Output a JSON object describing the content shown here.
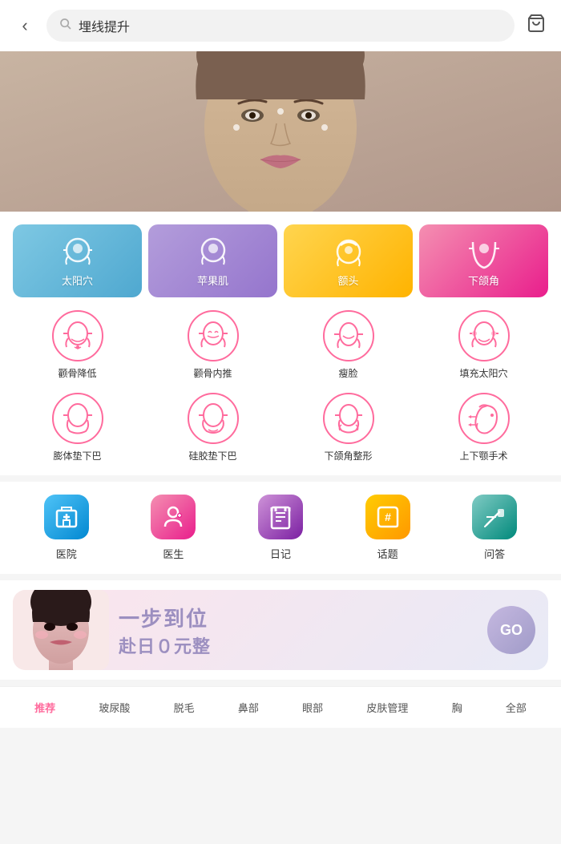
{
  "header": {
    "back_icon": "‹",
    "search_placeholder": "埋线提升",
    "cart_icon": "🛒"
  },
  "top_cards": [
    {
      "id": "taiping",
      "label": "太阳穴",
      "color": "card-blue"
    },
    {
      "id": "apple",
      "label": "苹果肌",
      "color": "card-purple"
    },
    {
      "id": "ehead",
      "label": "额头",
      "color": "card-yellow"
    },
    {
      "id": "jaw",
      "label": "下颌角",
      "color": "card-pink"
    }
  ],
  "icon_items_row1": [
    {
      "id": "zygomatic-lower",
      "label": "颧骨降低"
    },
    {
      "id": "zygomatic-inner",
      "label": "颧骨内推"
    },
    {
      "id": "slim-face",
      "label": "瘦脸"
    },
    {
      "id": "fill-temple",
      "label": "填充太阳穴"
    }
  ],
  "icon_items_row2": [
    {
      "id": "pad-chin",
      "label": "膨体垫下巴"
    },
    {
      "id": "silicone-chin",
      "label": "硅胶垫下巴"
    },
    {
      "id": "jaw-reshape",
      "label": "下颌角整形"
    },
    {
      "id": "jaw-surgery",
      "label": "上下颚手术"
    }
  ],
  "services": [
    {
      "id": "hospital",
      "label": "医院",
      "color": "service-icon-blue",
      "icon": "🏥"
    },
    {
      "id": "doctor",
      "label": "医生",
      "color": "service-icon-pink",
      "icon": "👨‍⚕️"
    },
    {
      "id": "diary",
      "label": "日记",
      "color": "service-icon-purple",
      "icon": "📋"
    },
    {
      "id": "topic",
      "label": "话题",
      "color": "service-icon-orange",
      "icon": "#"
    },
    {
      "id": "qa",
      "label": "问答",
      "color": "service-icon-teal",
      "icon": "✏️"
    }
  ],
  "promo": {
    "line1": "一步到位",
    "line2": "赴日０元整",
    "go_label": "GO"
  },
  "bottom_tabs": [
    {
      "id": "recommend",
      "label": "推荐",
      "active": true
    },
    {
      "id": "hyaluronic",
      "label": "玻尿酸"
    },
    {
      "id": "hair",
      "label": "脱毛"
    },
    {
      "id": "nose",
      "label": "鼻部"
    },
    {
      "id": "eye",
      "label": "眼部"
    },
    {
      "id": "skin",
      "label": "皮肤管理"
    },
    {
      "id": "chest",
      "label": "胸"
    },
    {
      "id": "all",
      "label": "全部"
    }
  ]
}
